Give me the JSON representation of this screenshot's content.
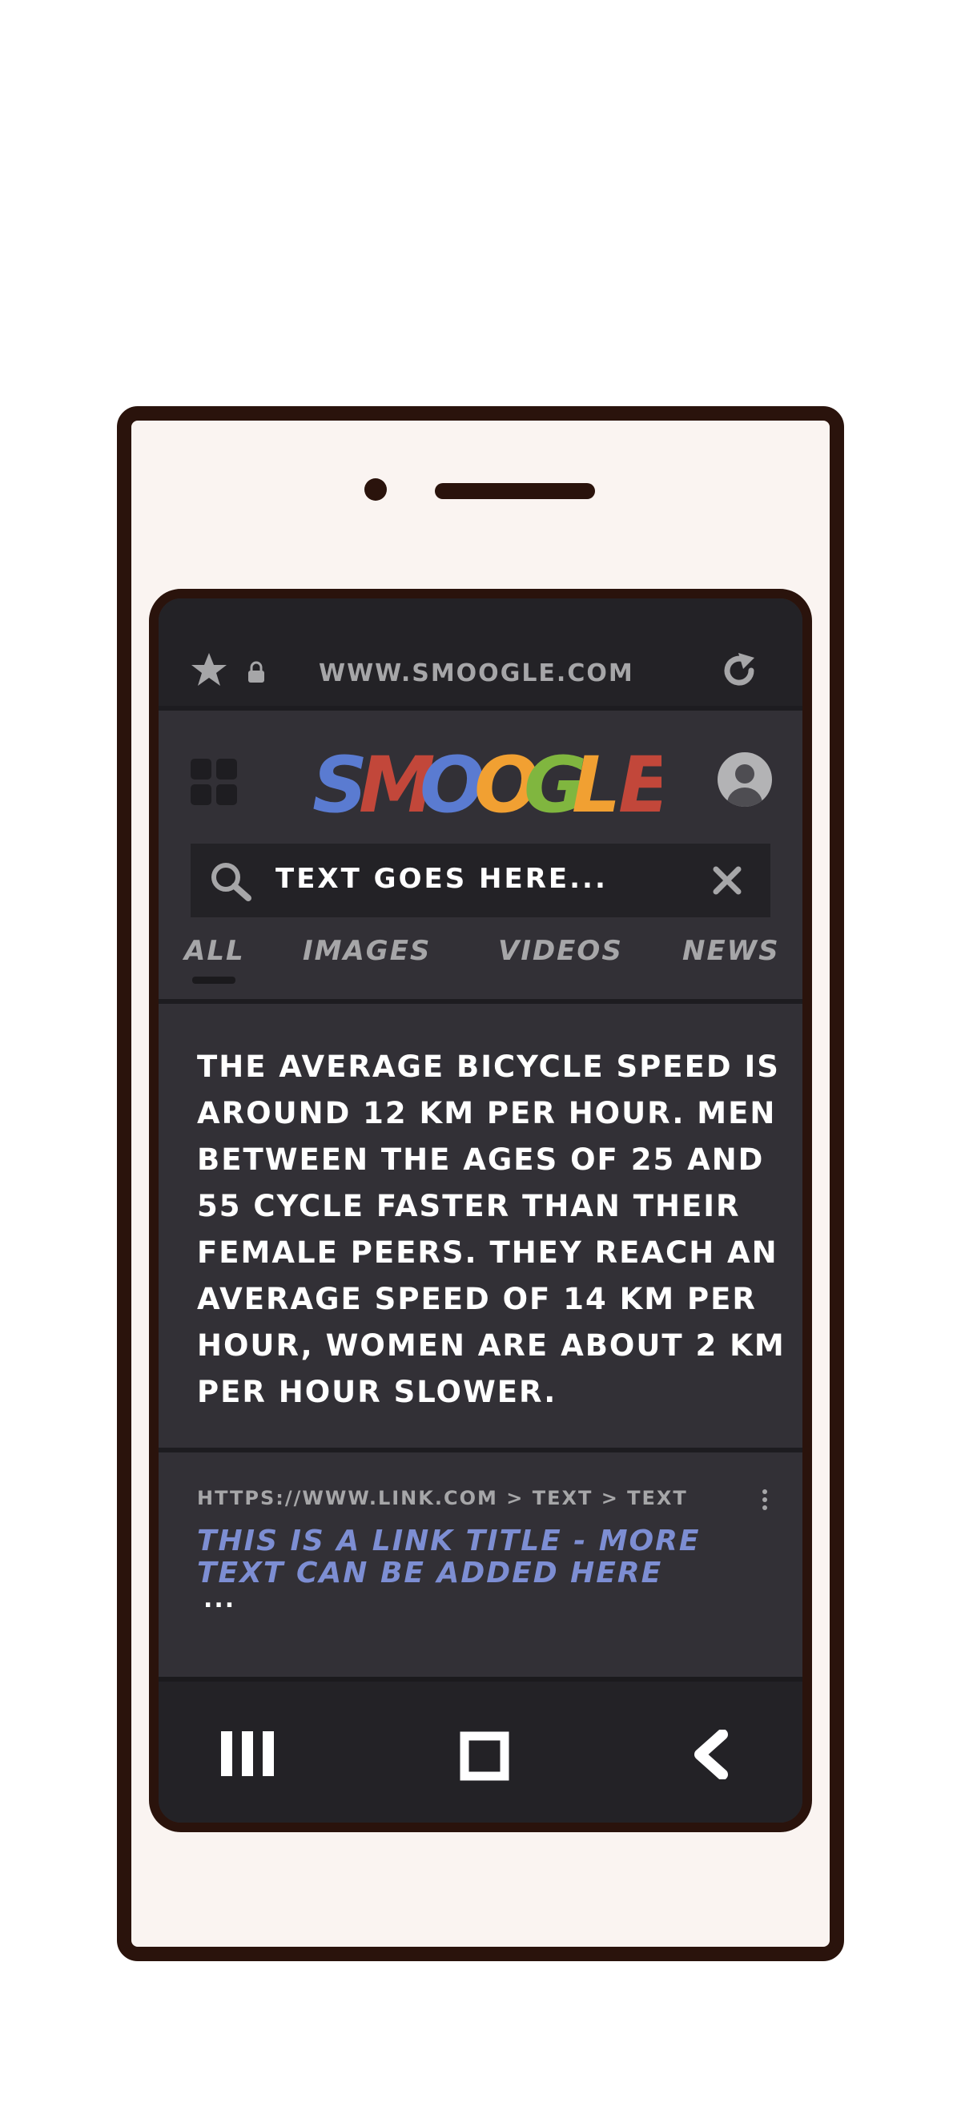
{
  "browser": {
    "url": "WWW.SMOOGLE.COM"
  },
  "header": {
    "logo_letters": [
      {
        "char": "S",
        "color": "#5a7bd1"
      },
      {
        "char": "M",
        "color": "#c2473a"
      },
      {
        "char": "O",
        "color": "#5a7bd1"
      },
      {
        "char": "O",
        "color": "#f1a032"
      },
      {
        "char": "G",
        "color": "#80b63f"
      },
      {
        "char": "L",
        "color": "#f1a032"
      },
      {
        "char": "E",
        "color": "#c2473a"
      }
    ]
  },
  "search": {
    "query": "TEXT GOES HERE..."
  },
  "tabs": [
    {
      "label": "ALL",
      "active": true
    },
    {
      "label": "IMAGES",
      "active": false
    },
    {
      "label": "VIDEOS",
      "active": false
    },
    {
      "label": "NEWS",
      "active": false
    }
  ],
  "answer": {
    "lines": [
      "THE AVERAGE BICYCLE SPEED IS",
      "AROUND 12 KM PER HOUR. MEN",
      "BETWEEN THE AGES OF 25 AND",
      "55 CYCLE FASTER THAN THEIR",
      "FEMALE PEERS. THEY REACH AN",
      "AVERAGE SPEED OF 14 KM PER",
      "HOUR, WOMEN ARE ABOUT 2 KM",
      "PER HOUR SLOWER."
    ]
  },
  "result": {
    "breadcrumb": "HTTPS://WWW.LINK.COM > TEXT > TEXT",
    "title_lines": [
      "THIS IS A LINK TITLE - MORE",
      "TEXT CAN BE ADDED HERE"
    ],
    "snippet": "..."
  },
  "colors": {
    "frame": "#2a130c",
    "phone_body": "#faf4f1",
    "screen_bg": "#323036",
    "bar_bg": "#232226",
    "link": "#7d8ed3",
    "muted_text": "#a6a6a8"
  }
}
